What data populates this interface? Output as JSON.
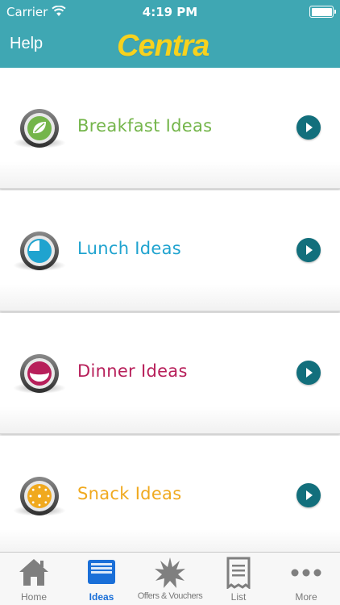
{
  "status_bar": {
    "carrier": "Carrier",
    "time": "4:19 PM"
  },
  "nav": {
    "help_label": "Help",
    "logo_text": "Centra",
    "logo_color": "#f7d21e",
    "bar_color": "#3fa7b3"
  },
  "ideas": [
    {
      "label": "Breakfast Ideas",
      "color": "#74b54a",
      "icon": "breakfast-leaf-icon"
    },
    {
      "label": "Lunch Ideas",
      "color": "#1fa3cf",
      "icon": "lunch-clock-icon"
    },
    {
      "label": "Dinner Ideas",
      "color": "#b71f5a",
      "icon": "dinner-plate-icon"
    },
    {
      "label": "Snack Ideas",
      "color": "#f0a91e",
      "icon": "snack-cookie-icon"
    }
  ],
  "tabs": [
    {
      "label": "Home",
      "icon": "home-icon",
      "active": false
    },
    {
      "label": "Ideas",
      "icon": "ideas-tray-icon",
      "active": true
    },
    {
      "label": "Offers & Vouchers",
      "icon": "starburst-icon",
      "active": false
    },
    {
      "label": "List",
      "icon": "receipt-list-icon",
      "active": false
    },
    {
      "label": "More",
      "icon": "more-dots-icon",
      "active": false
    }
  ]
}
